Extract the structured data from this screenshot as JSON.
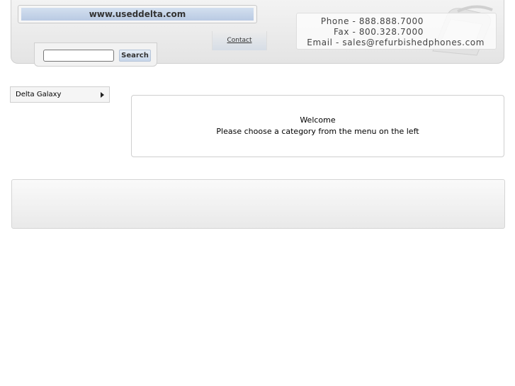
{
  "header": {
    "site_url": "www.useddelta.com",
    "nav": {
      "contact_label": "Contact"
    },
    "search": {
      "value": "",
      "button_label": "Search"
    },
    "contact": {
      "phone": "Phone - 888.888.7000",
      "fax": "Fax - 800.328.7000",
      "email": "Email - sales@refurbishedphones.com"
    }
  },
  "sidebar": {
    "items": [
      {
        "label": "Delta Galaxy",
        "icon": "chevron-right-icon"
      }
    ]
  },
  "main": {
    "title": "Welcome",
    "message": "Please choose a category from the menu on the left"
  }
}
